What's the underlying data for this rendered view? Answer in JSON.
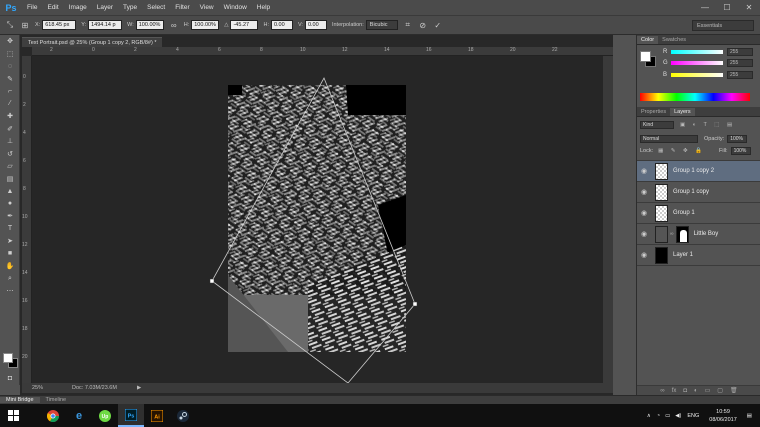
{
  "app": {
    "logo": "Ps"
  },
  "menu": [
    "File",
    "Edit",
    "Image",
    "Layer",
    "Type",
    "Select",
    "Filter",
    "View",
    "Window",
    "Help"
  ],
  "window_controls": {
    "minimize": "—",
    "maximize": "☐",
    "close": "✕"
  },
  "options": {
    "x_label": "X:",
    "x_value": "618.45 px",
    "y_label": "Y:",
    "y_value": "1494.14 p",
    "w_label": "W:",
    "w_value": "100.00%",
    "h_label": "H:",
    "h_value": "100.00%",
    "angle_label": "△",
    "angle_value": "-45.27",
    "hskew_label": "H:",
    "hskew_value": "0.00",
    "vskew_label": "V:",
    "vskew_value": "0.00",
    "interp_label": "Interpolation:",
    "interp_value": "Bicubic",
    "workspace": "Essentials"
  },
  "document": {
    "tab_title": "Text Portrait.psd @ 25% (Group 1 copy 2, RGB/8#) *",
    "zoom": "25%",
    "doc_size": "Doc: 7.03M/23.6M",
    "ruler_h": [
      "2",
      "0",
      "2",
      "4",
      "6",
      "8",
      "10",
      "12",
      "14",
      "16",
      "18",
      "20",
      "22"
    ],
    "ruler_v": [
      "0",
      "2",
      "4",
      "6",
      "8",
      "10",
      "12",
      "14",
      "16",
      "18",
      "20",
      "22"
    ]
  },
  "color_panel": {
    "tabs": [
      "Color",
      "Swatches"
    ],
    "channels": [
      {
        "label": "R",
        "value": "255"
      },
      {
        "label": "G",
        "value": "255"
      },
      {
        "label": "B",
        "value": "255"
      }
    ],
    "foreground": "#ffffff",
    "background": "#000000"
  },
  "layers_panel": {
    "tabs": [
      "Properties",
      "Layers"
    ],
    "filter_kind": "Kind",
    "blend_mode": "Normal",
    "opacity_label": "Opacity:",
    "opacity": "100%",
    "lock_label": "Lock:",
    "fill_label": "Fill:",
    "fill": "100%",
    "layers": [
      {
        "name": "Group 1 copy 2",
        "selected": true,
        "thumb": "checker"
      },
      {
        "name": "Group 1 copy",
        "selected": false,
        "thumb": "checker"
      },
      {
        "name": "Group 1",
        "selected": false,
        "thumb": "checker"
      },
      {
        "name": "Little Boy",
        "selected": false,
        "thumb": "photo"
      },
      {
        "name": "Layer 1",
        "selected": false,
        "thumb": "black"
      }
    ]
  },
  "bottom_tabs": [
    "Mini Bridge",
    "Timeline"
  ],
  "taskbar": {
    "start_icon": "windows-icon",
    "apps": [
      "chrome-icon",
      "edge-icon",
      "upwork-icon",
      "photoshop-icon",
      "illustrator-icon",
      "steam-icon"
    ],
    "language": "ENG",
    "time": "10:59",
    "date": "08/06/2017"
  }
}
